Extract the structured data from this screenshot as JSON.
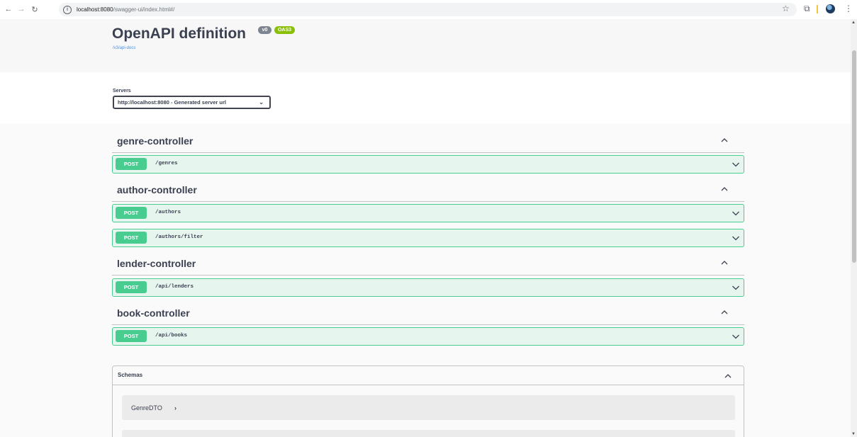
{
  "browser": {
    "url_host": "localhost:8080",
    "url_path": "/swagger-ui/index.html#/"
  },
  "info": {
    "title": "OpenAPI definition",
    "version_badge": "v0",
    "oas_badge": "OAS3",
    "docs_link": "/v3/api-docs"
  },
  "servers": {
    "label": "Servers",
    "selected": "http://localhost:8080 - Generated server url"
  },
  "tags": [
    {
      "name": "genre-controller",
      "operations": [
        {
          "method": "POST",
          "path": "/genres"
        }
      ]
    },
    {
      "name": "author-controller",
      "operations": [
        {
          "method": "POST",
          "path": "/authors"
        },
        {
          "method": "POST",
          "path": "/authors/filter"
        }
      ]
    },
    {
      "name": "lender-controller",
      "operations": [
        {
          "method": "POST",
          "path": "/api/lenders"
        }
      ]
    },
    {
      "name": "book-controller",
      "operations": [
        {
          "method": "POST",
          "path": "/api/books"
        }
      ]
    }
  ],
  "schemas": {
    "title": "Schemas",
    "items": [
      {
        "name": "GenreDTO"
      },
      {
        "name": ""
      }
    ]
  },
  "colors": {
    "post": "#49cc90",
    "badge_version": "#7d8492",
    "badge_oas": "#89bf04",
    "link": "#4990e2"
  },
  "icons": {
    "back": "arrow-left-icon",
    "forward": "arrow-right-icon",
    "reload": "reload-icon",
    "site_info": "info-icon",
    "bookmark": "star-icon",
    "extensions": "puzzle-icon",
    "profile": "avatar",
    "menu": "kebab-menu-icon"
  }
}
